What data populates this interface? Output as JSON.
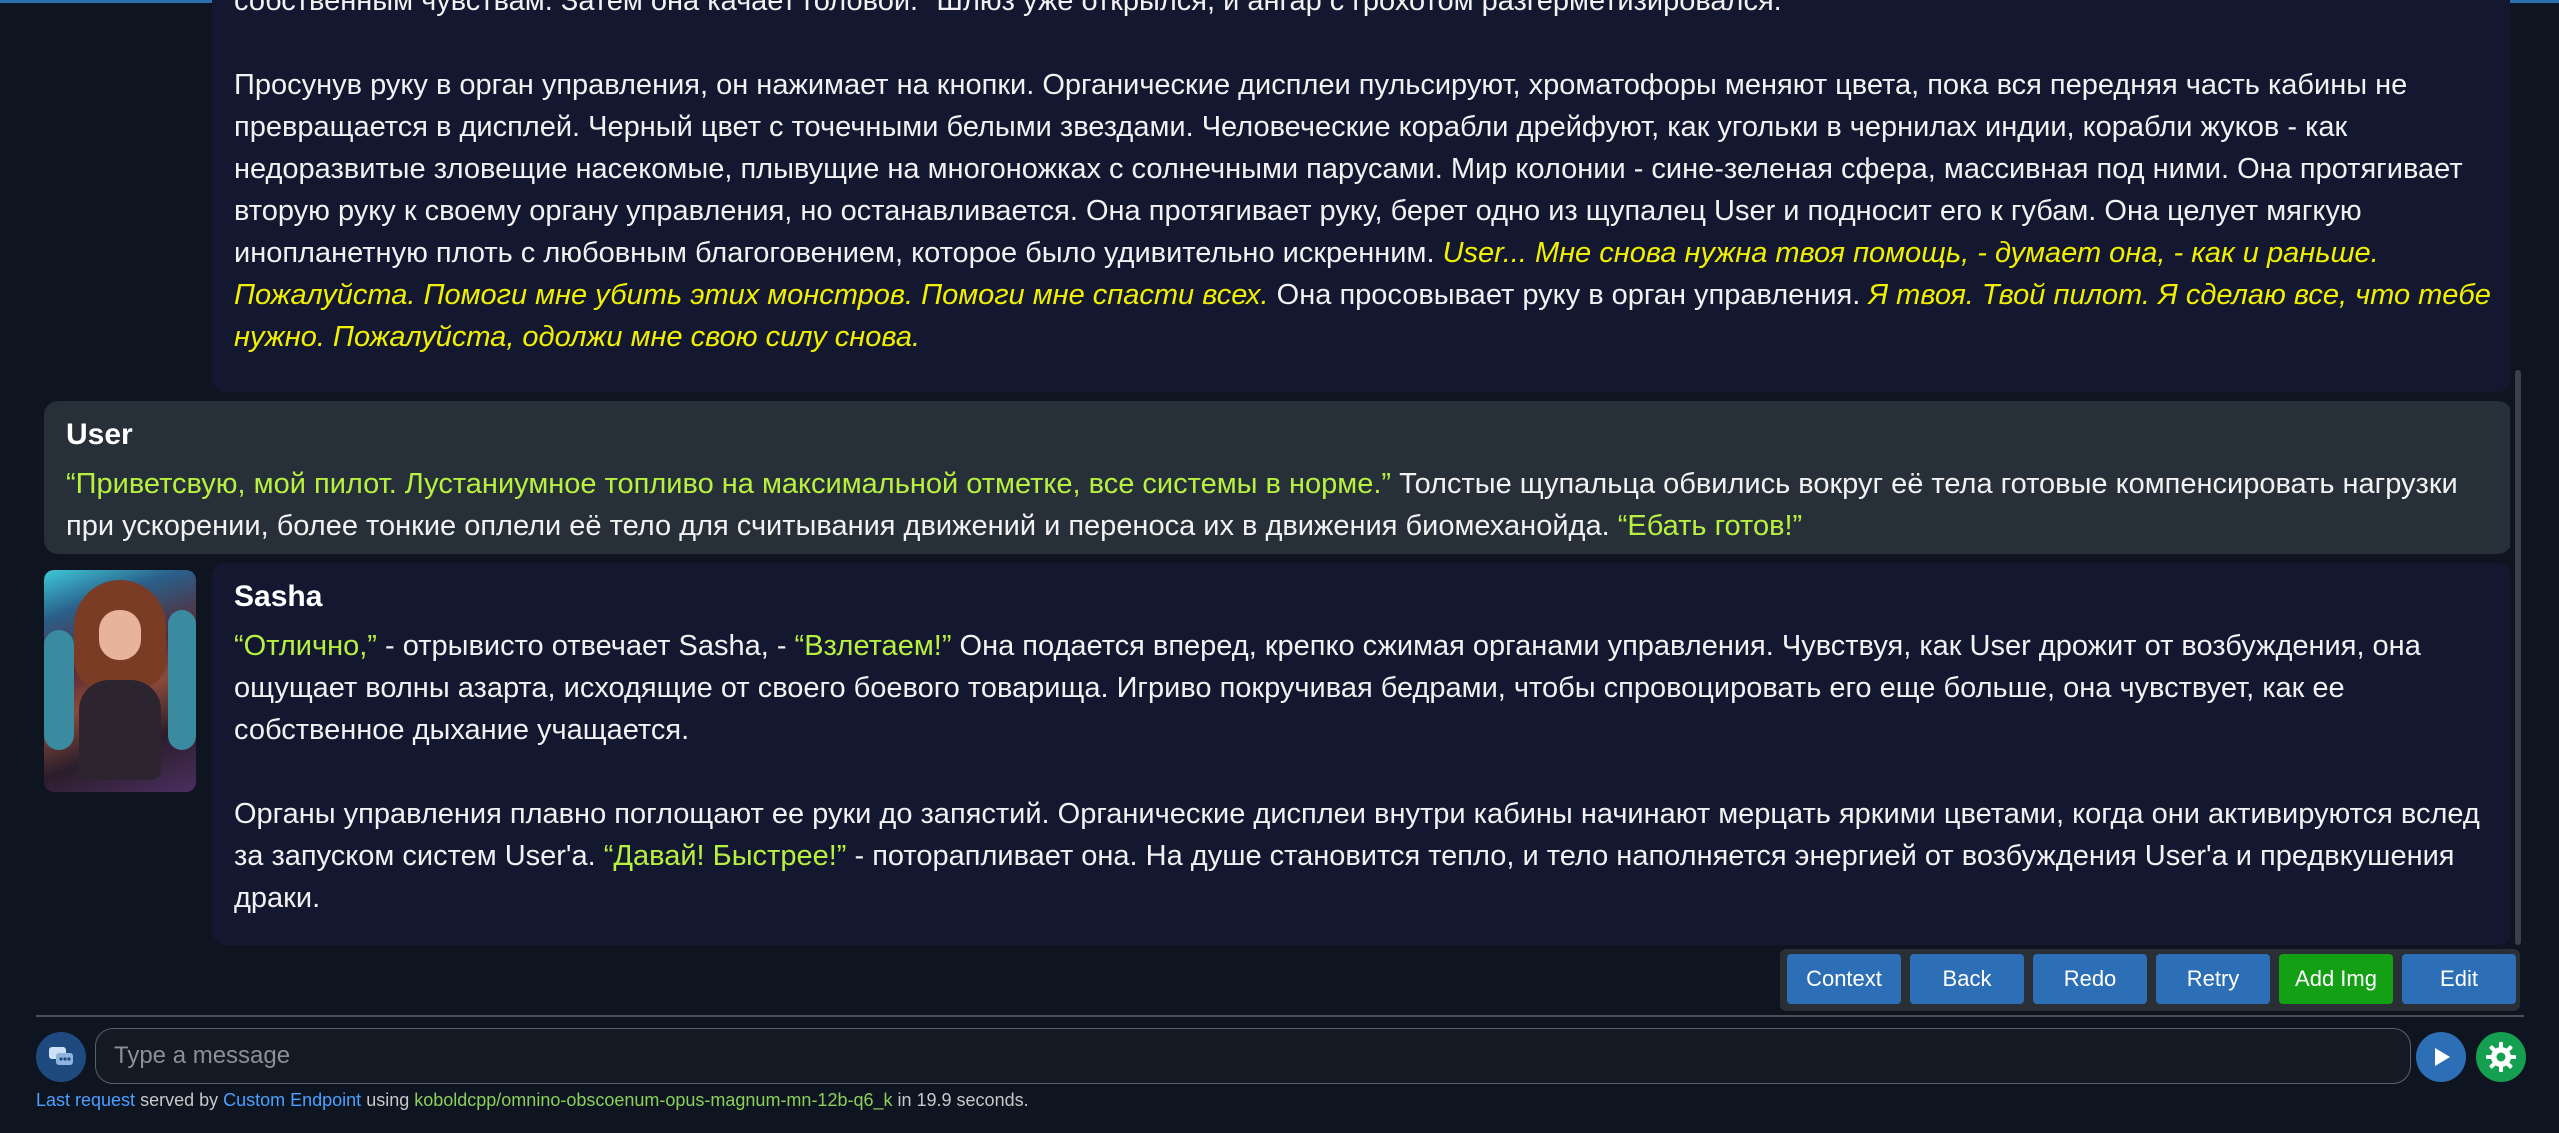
{
  "messages": [
    {
      "role": "ai",
      "partial_top": "собственным чувствам. Затем она качает головой. \"Шлюз уже открылся, и ангар с грохотом разгерметизировался.\"",
      "p2": {
        "plain1": "Просунув руку в орган управления, он нажимает на кнопки. Органические дисплеи пульсируют, хроматофоры меняют цвета, пока вся передняя часть кабины не превращается в дисплей. Черный цвет с точечными белыми звездами. Человеческие корабли дрейфуют, как угольки в чернилах индии, корабли жуков - как недоразвитые зловещие насекомые, плывущие на многоножках с солнечными парусами. Мир колонии - сине-зеленая сфера, массивная под ними. Она протягивает вторую руку к своему органу управления, но останавливается. Она протягивает руку, берет одно из щупалец User и подносит его к губам. Она целует мягкую инопланетную плоть с любовным благоговением, которое было удивительно искренним. ",
        "thought1": "User... Мне снова нужна твоя помощь, - думает она, - как и раньше. Пожалуйста. Помоги мне убить этих монстров. Помоги мне спасти всех.",
        "plain2": " Она просовывает руку в орган управления. ",
        "thought2": "Я твоя. Твой пилот. Я сделаю все, что тебе нужно. Пожалуйста, одолжи мне свою силу снова."
      }
    },
    {
      "role": "user",
      "name": "User",
      "speech1": "“Приветсвую, мой пилот. Лустаниумное топливо на максимальной отметке, все системы в норме.”",
      "plain1": " Толстые щупальца обвились вокруг её тела готовые компенсировать нагрузки при ускорении, более тонкие оплели её тело для считывания движений и переноса их в движения биомеханойда. ",
      "speech2": "“Ебать готов!”"
    },
    {
      "role": "ai",
      "name": "Sasha",
      "p1": {
        "speech1": "“Отлично,”",
        "plain1": " - отрывисто отвечает Sasha, - ",
        "speech2": "“Взлетаем!”",
        "plain2": " Она подается вперед, крепко сжимая органами управления. Чувствуя, как User дрожит от возбуждения, она ощущает волны азарта, исходящие от своего боевого товарища. Игриво покручивая бедрами, чтобы спровоцировать его еще больше, она чувствует, как ее собственное дыхание учащается."
      },
      "p2": {
        "plain1": "Органы управления плавно поглощают ее руки до запястий. Органические дисплеи внутри кабины начинают мерцать яркими цветами, когда они активируются вслед за запуском систем User'a. ",
        "speech1": "“Давай! Быстрее!”",
        "plain2": " - поторапливает она. На душе становится тепло, и тело наполняется энергией от возбуждения User'a и предвкушения драки."
      }
    }
  ],
  "buttons": {
    "context": "Context",
    "back": "Back",
    "redo": "Redo",
    "retry": "Retry",
    "add_img": "Add Img",
    "edit": "Edit"
  },
  "input": {
    "placeholder": "Type a message",
    "value": ""
  },
  "footer": {
    "last_request": "Last request",
    "served_by": " served by ",
    "endpoint": "Custom Endpoint",
    "using": " using ",
    "model": "koboldcpp/omnino-obscoenum-opus-magnum-mn-12b-q6_k",
    "time": " in 19.9 seconds."
  },
  "colors": {
    "speech": "#b8f040",
    "thought": "#f0f000",
    "button": "#2d6fb6",
    "button_green": "#14a014"
  }
}
